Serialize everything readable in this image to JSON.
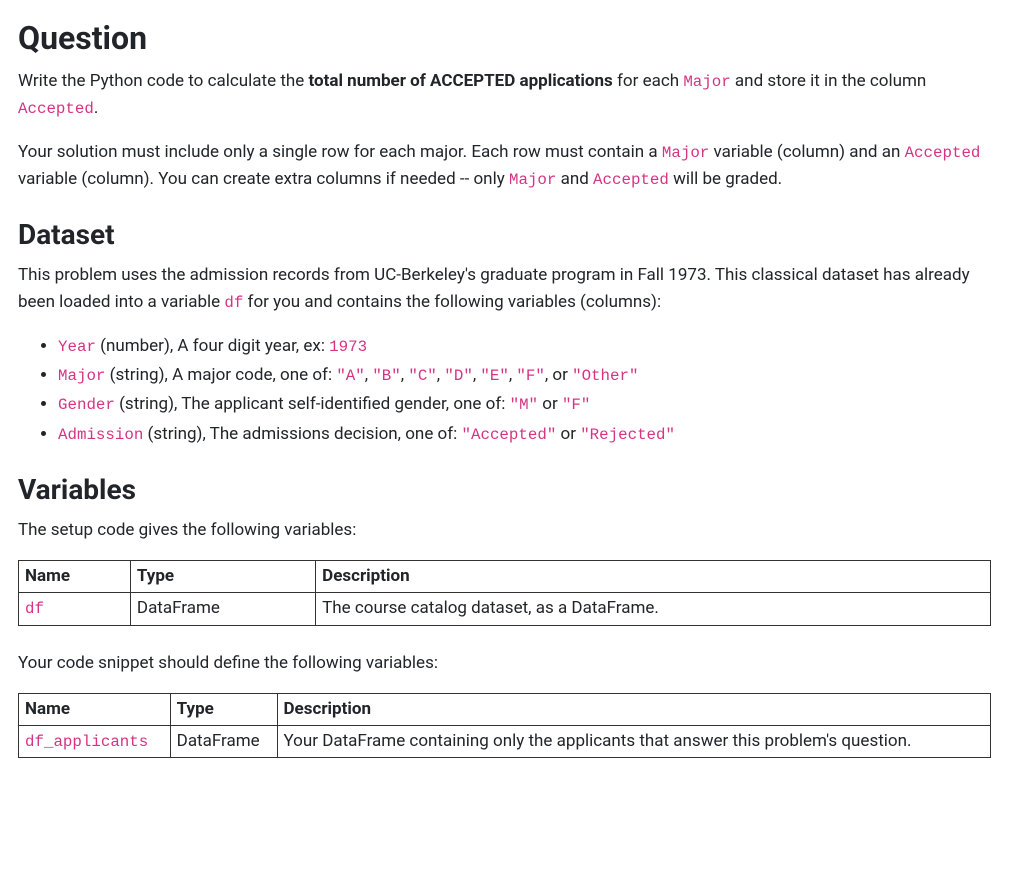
{
  "question": {
    "heading": "Question",
    "p1_a": "Write the Python code to calculate the ",
    "p1_bold": "total number of ACCEPTED applications",
    "p1_b": " for each ",
    "p1_code1": "Major",
    "p1_c": " and store it in the column ",
    "p1_code2": "Accepted",
    "p1_d": ".",
    "p2_a": "Your solution must include only a single row for each major. Each row must contain a ",
    "p2_code1": "Major",
    "p2_b": " variable (column) and an ",
    "p2_code2": "Accepted",
    "p2_c": " variable (column). You can create extra columns if needed -- only ",
    "p2_code3": "Major",
    "p2_d": " and ",
    "p2_code4": "Accepted",
    "p2_e": " will be graded."
  },
  "dataset": {
    "heading": "Dataset",
    "p_a": "This problem uses the admission records from UC-Berkeley's graduate program in Fall 1973. This classical dataset has already been loaded into a variable ",
    "p_code": "df",
    "p_b": " for you and contains the following variables (columns):",
    "li1": {
      "code1": "Year",
      "a": " (number), A four digit year, ex: ",
      "code2": "1973"
    },
    "li2": {
      "code1": "Major",
      "a": " (string), A major code, one of: ",
      "c1": "\"A\"",
      "s": ", ",
      "c2": "\"B\"",
      "c3": "\"C\"",
      "c4": "\"D\"",
      "c5": "\"E\"",
      "c6": "\"F\"",
      "or": ", or ",
      "c7": "\"Other\""
    },
    "li3": {
      "code1": "Gender",
      "a": " (string), The applicant self-identified gender, one of: ",
      "c1": "\"M\"",
      "or": " or ",
      "c2": "\"F\""
    },
    "li4": {
      "code1": "Admission",
      "a": " (string), The admissions decision, one of: ",
      "c1": "\"Accepted\"",
      "or": " or ",
      "c2": "\"Rejected\""
    }
  },
  "variables": {
    "heading": "Variables",
    "lead1": "The setup code gives the following variables:",
    "table1": {
      "h1": "Name",
      "h2": "Type",
      "h3": "Description",
      "r1c1": "df",
      "r1c2": "DataFrame",
      "r1c3": "The course catalog dataset, as a DataFrame."
    },
    "lead2": "Your code snippet should define the following variables:",
    "table2": {
      "h1": "Name",
      "h2": "Type",
      "h3": "Description",
      "r1c1": "df_applicants",
      "r1c2": "DataFrame",
      "r1c3": "Your DataFrame containing only the applicants that answer this problem's question."
    }
  }
}
